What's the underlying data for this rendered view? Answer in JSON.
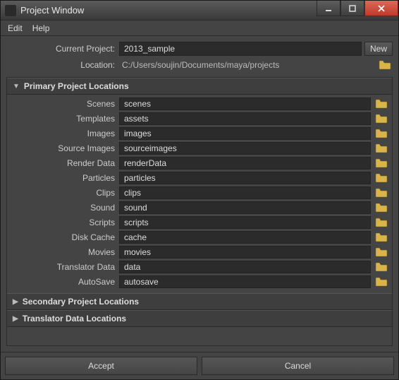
{
  "window": {
    "title": "Project Window"
  },
  "menu": {
    "edit": "Edit",
    "help": "Help"
  },
  "header": {
    "current_project_label": "Current Project:",
    "current_project_value": "2013_sample",
    "new_button": "New",
    "location_label": "Location:",
    "location_value": "C:/Users/soujin/Documents/maya/projects"
  },
  "sections": {
    "primary": {
      "title": "Primary Project Locations",
      "expanded": true,
      "fields": [
        {
          "label": "Scenes",
          "value": "scenes"
        },
        {
          "label": "Templates",
          "value": "assets"
        },
        {
          "label": "Images",
          "value": "images"
        },
        {
          "label": "Source Images",
          "value": "sourceimages"
        },
        {
          "label": "Render Data",
          "value": "renderData"
        },
        {
          "label": "Particles",
          "value": "particles"
        },
        {
          "label": "Clips",
          "value": "clips"
        },
        {
          "label": "Sound",
          "value": "sound"
        },
        {
          "label": "Scripts",
          "value": "scripts"
        },
        {
          "label": "Disk Cache",
          "value": "cache"
        },
        {
          "label": "Movies",
          "value": "movies"
        },
        {
          "label": "Translator Data",
          "value": "data"
        },
        {
          "label": "AutoSave",
          "value": "autosave"
        }
      ]
    },
    "secondary": {
      "title": "Secondary Project Locations",
      "expanded": false
    },
    "translator": {
      "title": "Translator Data Locations",
      "expanded": false
    }
  },
  "footer": {
    "accept": "Accept",
    "cancel": "Cancel"
  }
}
